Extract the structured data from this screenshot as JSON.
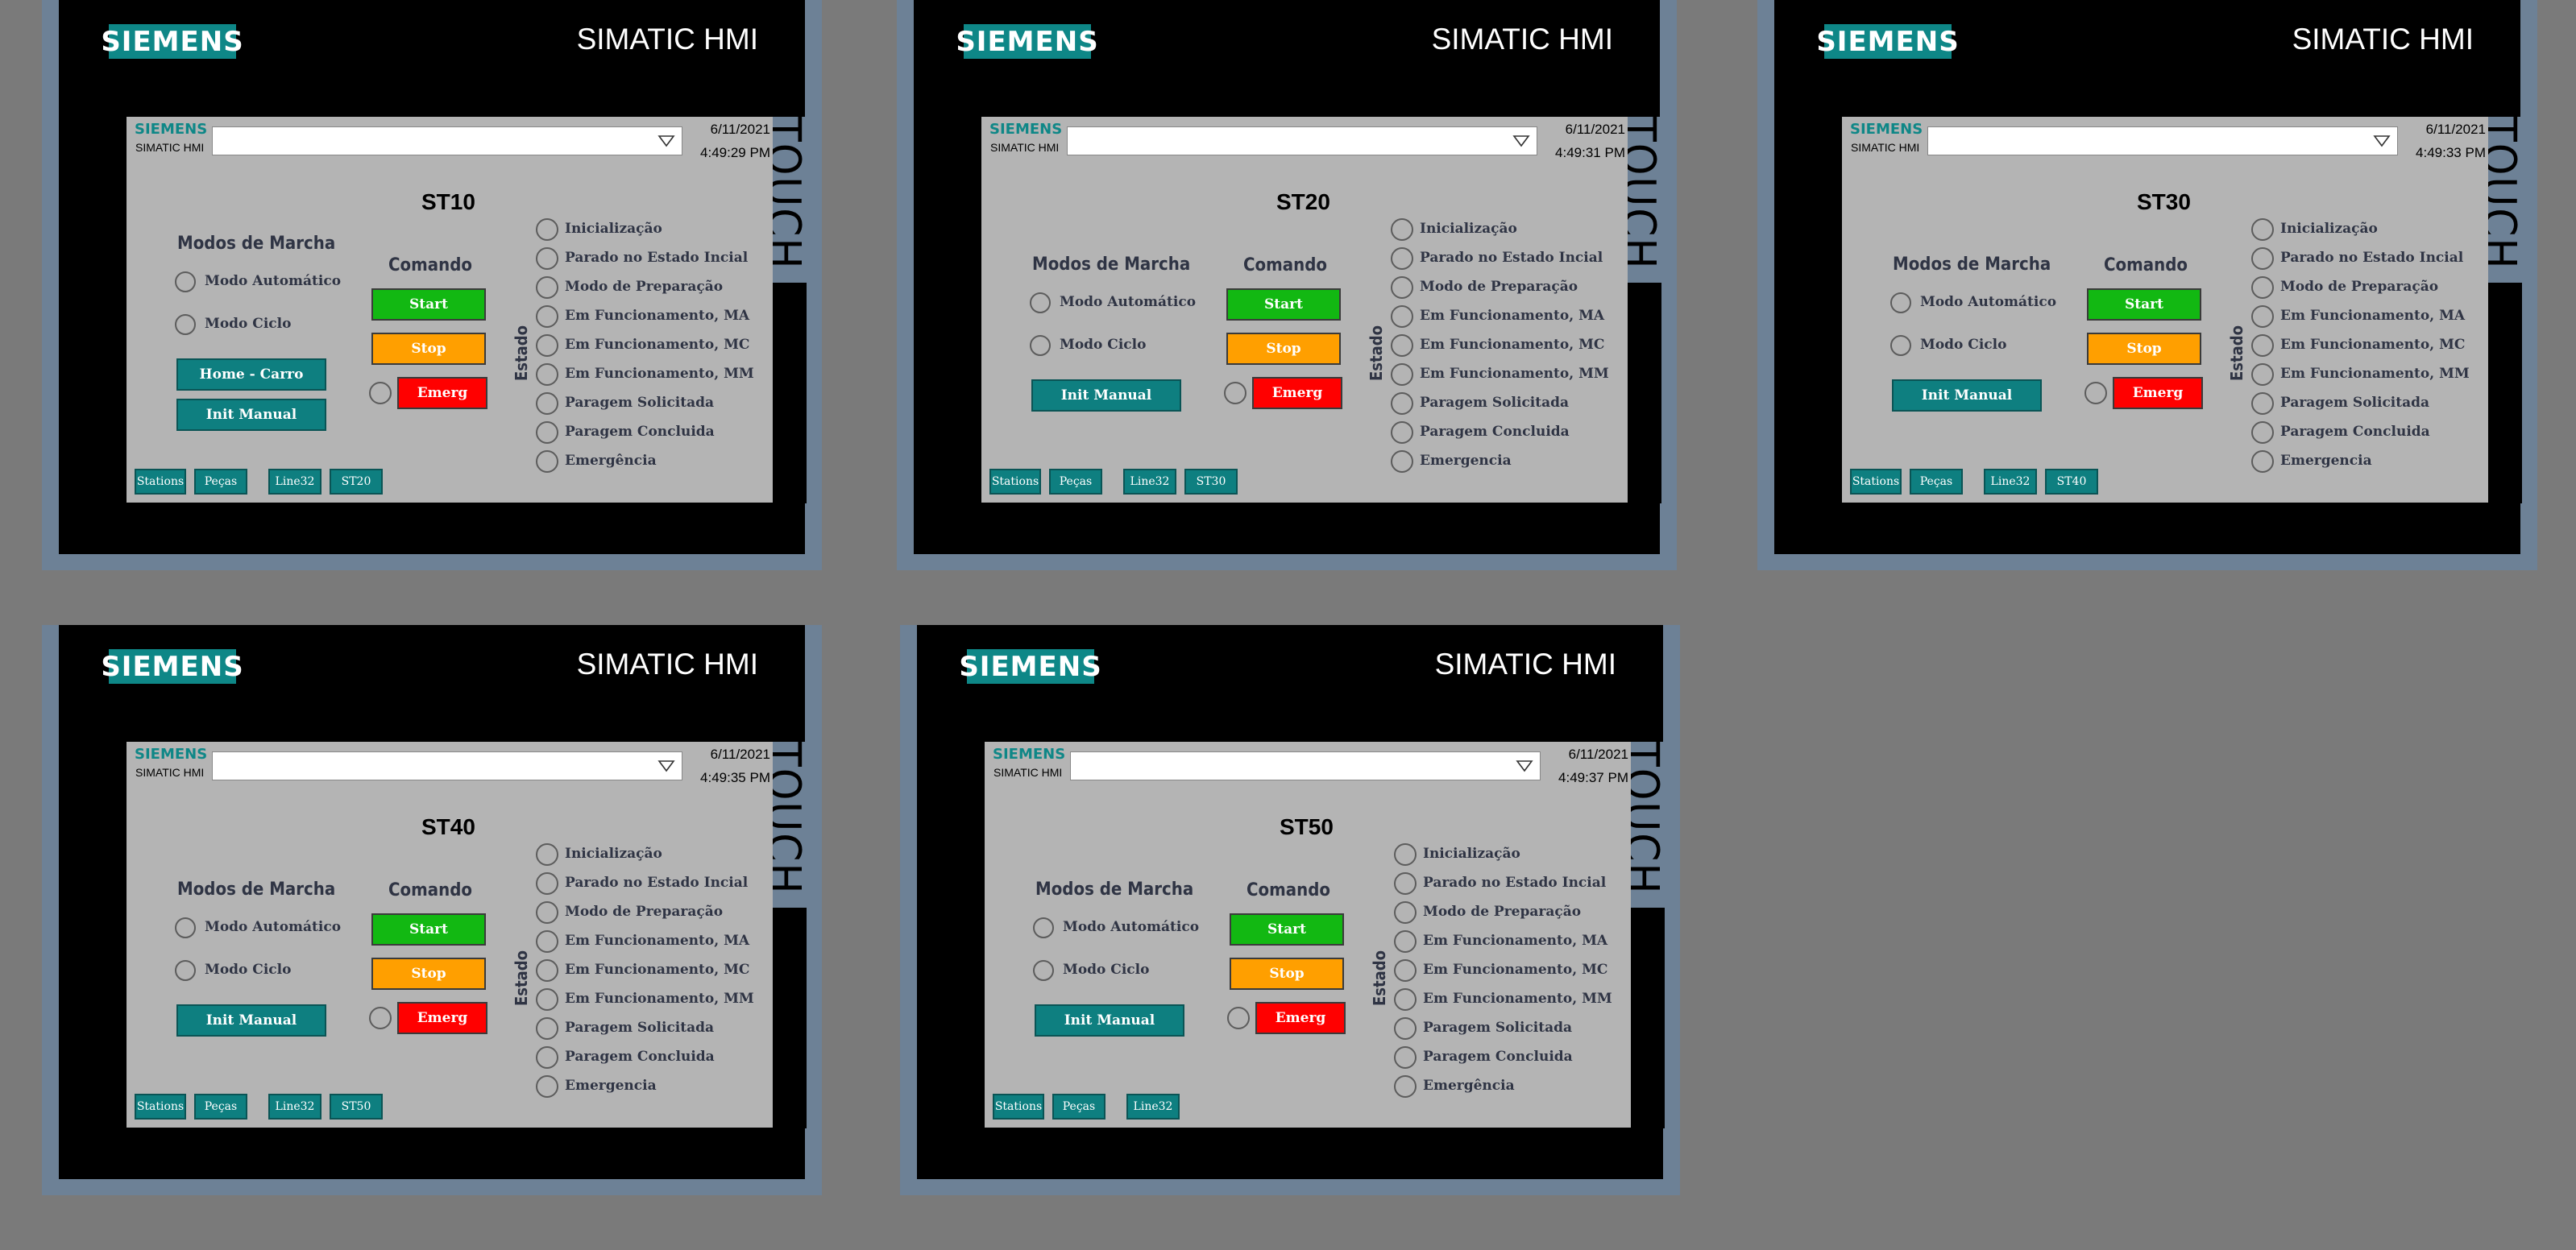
{
  "brand": "SIEMENS",
  "device_title": "SIMATIC HMI",
  "touch_label": "TOUCH",
  "screen_brand": "SIEMENS",
  "screen_sub": "SIMATIC HMI",
  "labels": {
    "modos_de_marcha": "Modos de Marcha",
    "modo_automatico": "Modo Automático",
    "modo_ciclo": "Modo Ciclo",
    "comando": "Comando",
    "start": "Start",
    "stop": "Stop",
    "emerg": "Emerg",
    "estado": "Estado",
    "home_carro": "Home - Carro",
    "init_manual": "Init Manual"
  },
  "states": [
    "Inicialização",
    "Parado no Estado Incial",
    "Modo de Preparação",
    "Em Funcionamento, MA",
    "Em Funcionamento, MC",
    "Em Funcionamento, MM",
    "Paragem Solicitada",
    "Paragem Concluida",
    "Emergência",
    "Emergencia"
  ],
  "colors": {
    "teal": "#0e7f80",
    "start": "#12b812",
    "stop": "#ff9f00",
    "emerg": "#ff0000"
  },
  "panels": [
    {
      "station": "ST10",
      "date": "6/11/2021",
      "time": "4:49:29 PM",
      "has_home": true,
      "last_state": "Emergência",
      "nav": [
        "Stations",
        "Peças",
        "Line32",
        "ST20"
      ]
    },
    {
      "station": "ST20",
      "date": "6/11/2021",
      "time": "4:49:31 PM",
      "has_home": false,
      "last_state": "Emergencia",
      "nav": [
        "Stations",
        "Peças",
        "Line32",
        "ST30"
      ]
    },
    {
      "station": "ST30",
      "date": "6/11/2021",
      "time": "4:49:33 PM",
      "has_home": false,
      "last_state": "Emergencia",
      "nav": [
        "Stations",
        "Peças",
        "Line32",
        "ST40"
      ]
    },
    {
      "station": "ST40",
      "date": "6/11/2021",
      "time": "4:49:35 PM",
      "has_home": false,
      "last_state": "Emergencia",
      "nav": [
        "Stations",
        "Peças",
        "Line32",
        "ST50"
      ]
    },
    {
      "station": "ST50",
      "date": "6/11/2021",
      "time": "4:49:37 PM",
      "has_home": false,
      "last_state": "Emergência",
      "nav": [
        "Stations",
        "Peças",
        "Line32"
      ]
    }
  ]
}
